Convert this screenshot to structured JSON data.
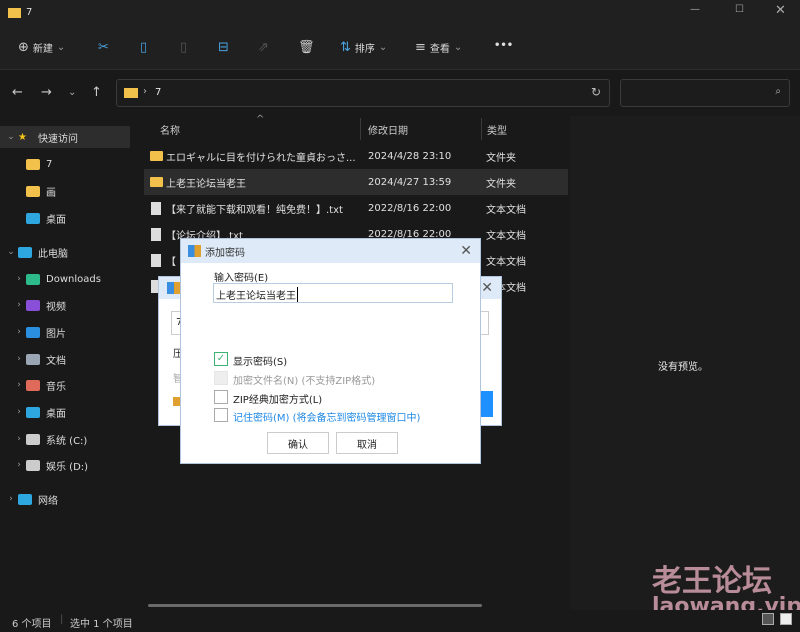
{
  "window": {
    "title": "7"
  },
  "toolbar": {
    "new": "新建",
    "sort": "排序",
    "view": "查看",
    "more": "•••"
  },
  "address": {
    "path": "7"
  },
  "sidebar": {
    "items": [
      {
        "label": "快速访问",
        "icon": "star-icon",
        "color": "#f5c518"
      },
      {
        "label": "7",
        "icon": "folder-icon",
        "color": "#f2c14b"
      },
      {
        "label": "画",
        "icon": "folder-icon",
        "color": "#f2c14b"
      },
      {
        "label": "桌面",
        "icon": "desktop-icon",
        "color": "#2ea7e0"
      },
      {
        "label": "此电脑",
        "icon": "computer-icon",
        "color": "#2ea7e0"
      },
      {
        "label": "Downloads",
        "icon": "download-icon",
        "color": "#2dbb8b"
      },
      {
        "label": "视频",
        "icon": "video-icon",
        "color": "#8a4fd8"
      },
      {
        "label": "图片",
        "icon": "picture-icon",
        "color": "#2b8fe0"
      },
      {
        "label": "文档",
        "icon": "document-icon",
        "color": "#9aa6b4"
      },
      {
        "label": "音乐",
        "icon": "music-icon",
        "color": "#e06a5a"
      },
      {
        "label": "桌面",
        "icon": "desktop-icon",
        "color": "#2ea7e0"
      },
      {
        "label": "系统 (C:)",
        "icon": "drive-icon",
        "color": "#cccccc"
      },
      {
        "label": "娱乐 (D:)",
        "icon": "drive-icon",
        "color": "#cccccc"
      },
      {
        "label": "网络",
        "icon": "network-icon",
        "color": "#2ea7e0"
      }
    ]
  },
  "columns": {
    "name": "名称",
    "date": "修改日期",
    "type": "类型"
  },
  "files": [
    {
      "name": "エロギャルに目を付けられた童貞おっさ...",
      "date": "2024/4/28 23:10",
      "type": "文件夹",
      "kind": "folder"
    },
    {
      "name": "上老王论坛当老王",
      "date": "2024/4/27 13:59",
      "type": "文件夹",
      "kind": "folder"
    },
    {
      "name": "【来了就能下载和观看！纯免费！】.txt",
      "date": "2022/8/16 22:00",
      "type": "文本文档",
      "kind": "doc"
    },
    {
      "name": "【论坛介绍】.txt",
      "date": "2022/8/16 22:00",
      "type": "文本文档",
      "kind": "doc"
    },
    {
      "name": "【",
      "date": "",
      "type": "文本文档",
      "kind": "doc"
    },
    {
      "name": "",
      "date": "",
      "type": "文本文档",
      "kind": "doc"
    }
  ],
  "preview": {
    "empty": "没有预览。"
  },
  "status": {
    "count": "6 个项目",
    "selected": "选中 1 个项目"
  },
  "back_dialog": {
    "field": "7",
    "label1": "压",
    "label2": "智"
  },
  "dialog": {
    "title": "添加密码",
    "input_label": "输入密码(E)",
    "password": "上老王论坛当老王",
    "options": [
      {
        "label": "显示密码(S)",
        "checked": true,
        "disabled": false
      },
      {
        "label": "加密文件名(N) (不支持ZIP格式)",
        "checked": false,
        "disabled": true
      },
      {
        "label": "ZIP经典加密方式(L)",
        "checked": false,
        "disabled": false
      },
      {
        "label": "记住密码(M) (将会备忘到密码管理窗口中)",
        "checked": false,
        "disabled": false
      }
    ],
    "ok": "确认",
    "cancel": "取消"
  },
  "watermark": {
    "cn": "老王论坛",
    "url": "laowang.vip"
  }
}
